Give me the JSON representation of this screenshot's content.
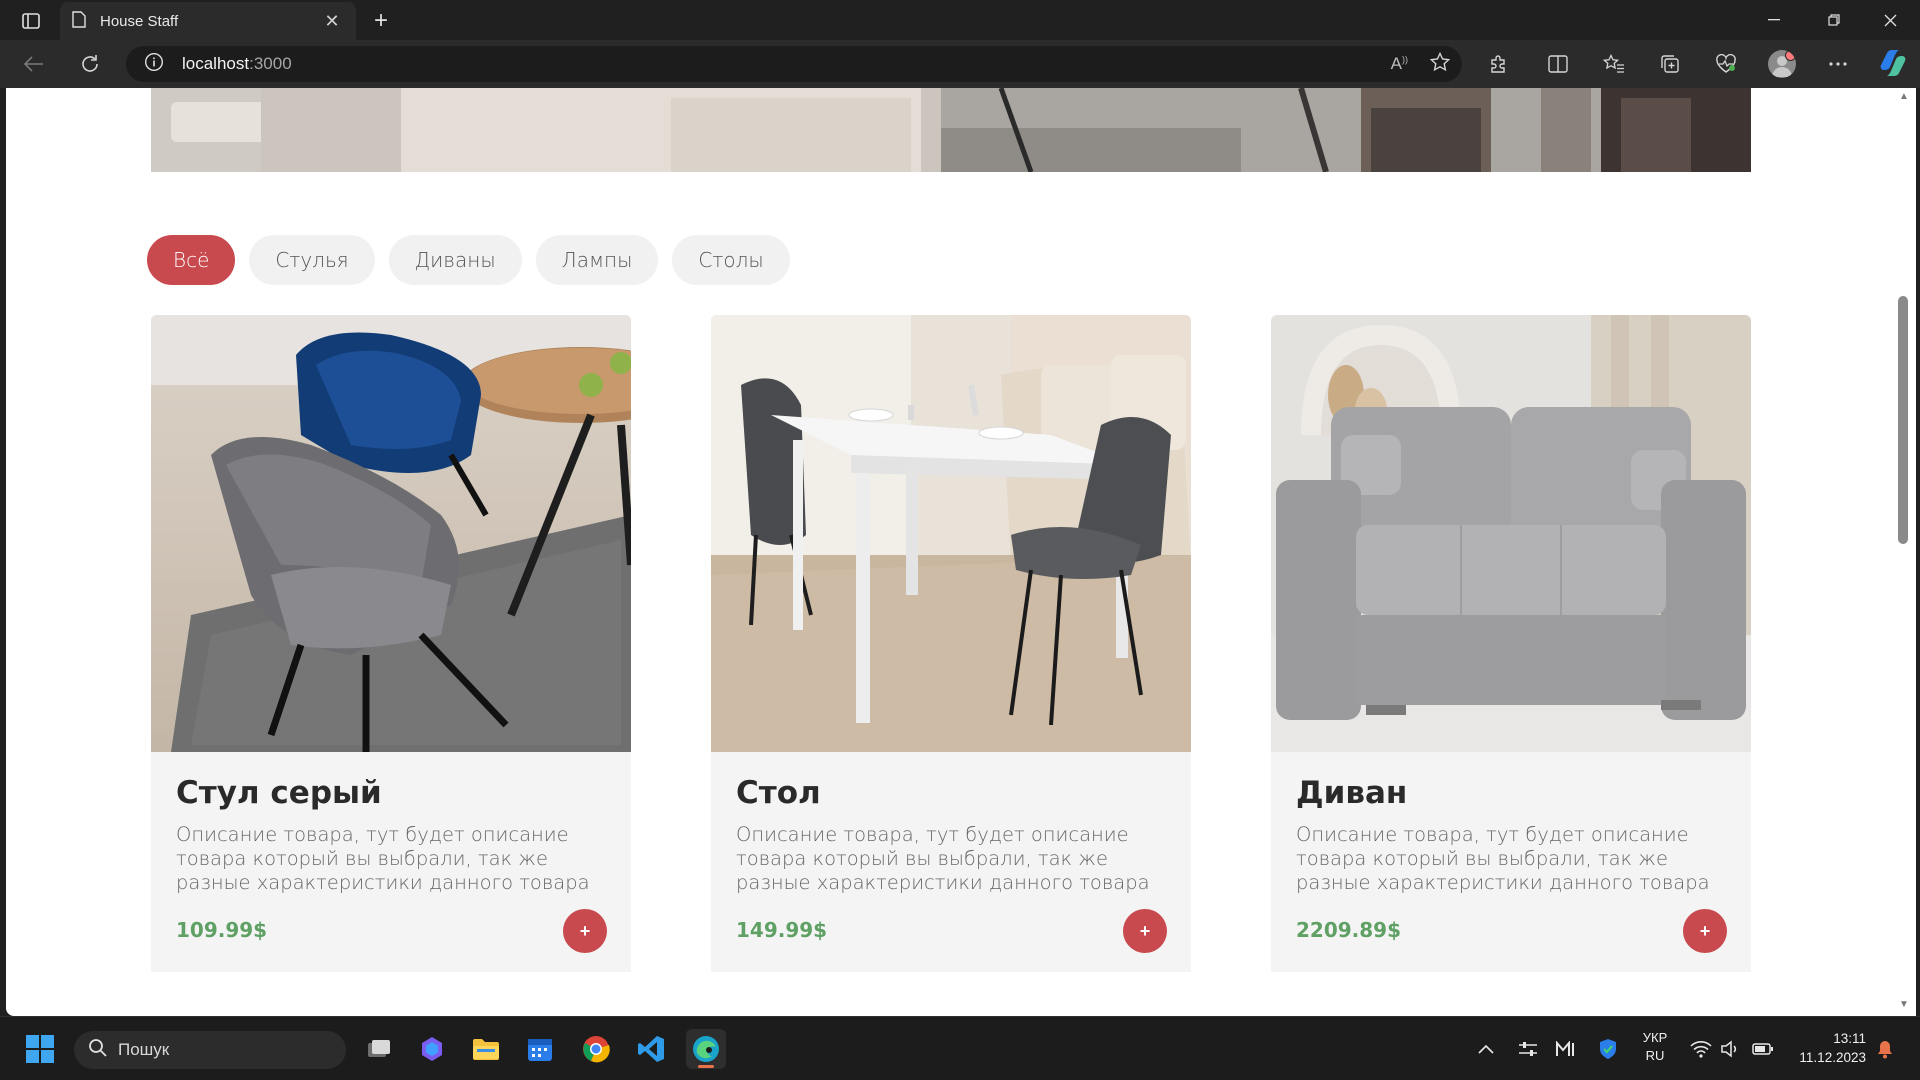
{
  "browser": {
    "tab_title": "House Staff",
    "url_host": "localhost",
    "url_port": ":3000"
  },
  "filters": [
    {
      "label": "Всё",
      "active": true
    },
    {
      "label": "Стулья",
      "active": false
    },
    {
      "label": "Диваны",
      "active": false
    },
    {
      "label": "Лампы",
      "active": false
    },
    {
      "label": "Столы",
      "active": false
    }
  ],
  "products": [
    {
      "name": "Стул серый",
      "description": "Описание товара, тут будет описание товара который вы выбрали, так же разные характеристики данного товара",
      "price": "109.99$",
      "add_label": "+"
    },
    {
      "name": "Стол",
      "description": "Описание товара, тут будет описание товара который вы выбрали, так же разные характеристики данного товара",
      "price": "149.99$",
      "add_label": "+"
    },
    {
      "name": "Диван",
      "description": "Описание товара, тут будет описание товара который вы выбрали, так же разные характеристики данного товара",
      "price": "2209.89$",
      "add_label": "+"
    }
  ],
  "taskbar": {
    "search_placeholder": "Пошук",
    "lang_top": "УКР",
    "lang_bottom": "RU",
    "time": "13:11",
    "date": "11.12.2023"
  },
  "colors": {
    "accent": "#c8494e",
    "price": "#5fa064",
    "chip_bg": "#f1f1f1"
  }
}
